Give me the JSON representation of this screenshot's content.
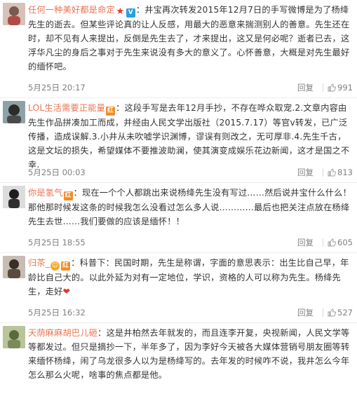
{
  "comments": [
    {
      "username": "任何一种美好都是命定",
      "text": "：井宝再次转发2015年12月7日的手写微博是为了杨绛先生的逝去。但某些评论真的让人反感，用最大的恶意来揣测别人的善意。先生还在时，却不见有人来提出，反倒是先生去了，才来提出，这又是何必呢？逝者已去，这浮华凡尘的身后之事对于先生来说没有多大的意义了。心怀善意，大概是对先生最好的缅怀吧。",
      "date": "5月25日 20:17",
      "reply": "回复",
      "likes": "991",
      "avatar_color": "#c9a6a0"
    },
    {
      "username": "LOL生活需要正能量",
      "text": "：这段手写是去年12月手抄，不存在哗众取宠.2.文章内容由先生作品拼凑加工而成，并经由人民文学出版社（2015.7.17）等官v转发，已广泛传播，造成误解.3.小井从未吹嘘学识渊博，谬误有则改之，无可厚非.4.先生千古，这是文坛的损失，希望媒体不要推波助澜，使其演变成娱乐花边新闻，这才是国之不幸.",
      "date": "5月25日 00:03",
      "reply": "回复",
      "likes": "813",
      "avatar_color": "#6b7c82"
    },
    {
      "username": "你是氢气",
      "text": "：现在一个个人都跳出来说杨绛先生没有写过……然后说井宝什么什么！那他那时候发这条的时候我怎么没看过怎么多人说…………最后也把关注点放在杨绛先生去世……我们要做的应该是缅怀！！",
      "date": "5月25日 18:55",
      "reply": "回复",
      "likes": "605",
      "avatar_color": "#3b3b3b"
    },
    {
      "username": "归茶_",
      "text": "：科普下：民国时期，先生是称谓，字面的意思表示：出生比自己早，年龄比自己大的。以此外延为对有一定地位，学识，资格的人可以称为先生。杨绛先生，走好",
      "date": "5月25日 16:32",
      "reply": "回复",
      "likes": "527",
      "avatar_color": "#8a7a70"
    },
    {
      "username": "天荫麻麻胡巴儿砸",
      "text": "：这是井柏然去年就发的，而且连李开复，央视新闻，人民文学等等都发过。但只是摘抄一下，半年多了，因为李好今天被各大媒体营销号朋友圈等转来缅怀杨绛，闹了乌龙很多人以为是杨绛写的。去年发的时候咋不说，我井怎么今年怎么那么火呢，啥事的焦点都是他。",
      "date": "",
      "reply": "回复",
      "likes": "",
      "avatar_color": "#9aa37a"
    }
  ],
  "colors": {
    "username": "#eb7350",
    "text": "#333333",
    "meta": "#808080"
  }
}
